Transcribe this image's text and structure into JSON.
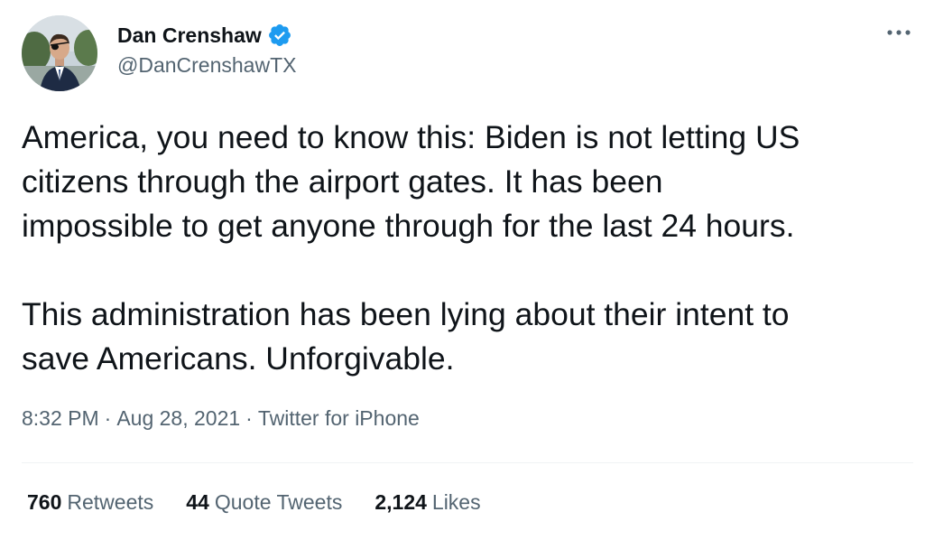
{
  "author": {
    "display_name": "Dan Crenshaw",
    "handle": "@DanCrenshawTX",
    "verified": true,
    "avatar_icon": "profile-photo"
  },
  "tweet": {
    "paragraphs": [
      [
        "America, you need to know this: Biden is not letting US",
        "citizens through the airport gates. It has been",
        "impossible to get anyone through for the last 24 hours."
      ],
      [
        "This administration has been lying about their intent to",
        "save Americans. Unforgivable."
      ]
    ],
    "time": "8:32 PM",
    "date": "Aug 28, 2021",
    "source": "Twitter for iPhone",
    "separator": "·"
  },
  "stats": {
    "retweets": {
      "count": "760",
      "label": "Retweets"
    },
    "quote_tweets": {
      "count": "44",
      "label": "Quote Tweets"
    },
    "likes": {
      "count": "2,124",
      "label": "Likes"
    }
  },
  "colors": {
    "text_primary": "#0f1419",
    "text_secondary": "#536471",
    "verified_blue": "#1d9bf0",
    "divider": "#eff3f4"
  }
}
